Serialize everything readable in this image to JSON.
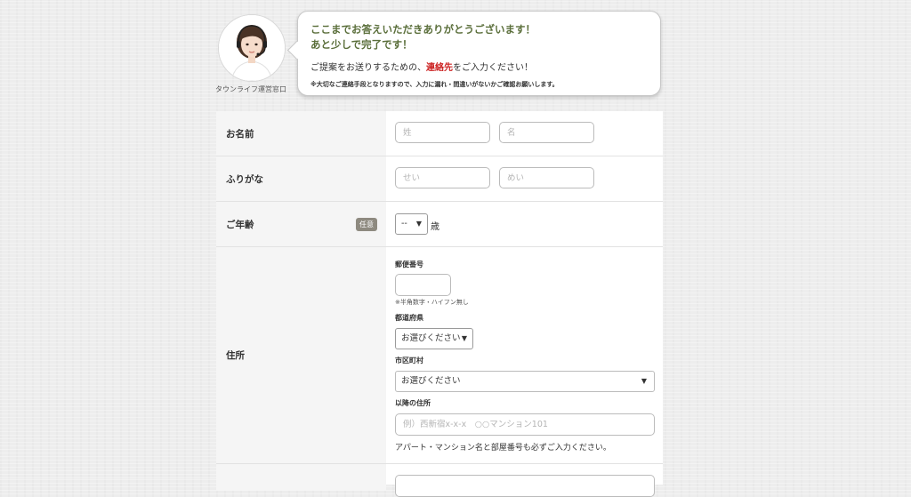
{
  "operator": {
    "caption": "タウンライフ運営窓口"
  },
  "bubble": {
    "heading_line1": "ここまでお答えいただきありがとうございます！",
    "heading_line2": "あと少しで完了です！",
    "body_prefix": "ご提案をお送りするための、",
    "body_accent": "連絡先",
    "body_suffix": "をご入力ください！",
    "note": "※大切なご連絡手段となりますので、入力に漏れ・間違いがないかご確認お願いします。",
    "accent_color": "#cc2222",
    "heading_color": "#5a6e3a"
  },
  "form": {
    "name": {
      "label": "お名前",
      "last_placeholder": "姓",
      "first_placeholder": "名"
    },
    "furigana": {
      "label": "ふりがな",
      "last_placeholder": "せい",
      "first_placeholder": "めい"
    },
    "age": {
      "label": "ご年齢",
      "badge": "任意",
      "selected": "--",
      "unit": "歳"
    },
    "address": {
      "label": "住所",
      "postal_label": "郵便番号",
      "postal_note": "※半角数字・ハイフン無し",
      "prefecture_label": "都道府県",
      "prefecture_selected": "お選びください",
      "city_label": "市区町村",
      "city_selected": "お選びください",
      "street_label": "以降の住所",
      "street_placeholder": "例）西新宿x-x-x　○○マンション101",
      "street_note": "アパート・マンション名と部屋番号も必ずご入力ください。"
    }
  }
}
